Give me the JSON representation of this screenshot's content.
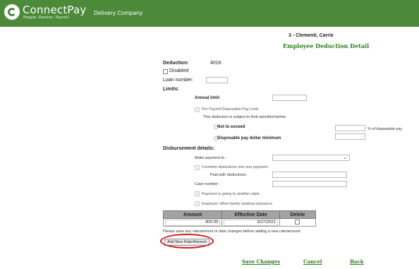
{
  "header": {
    "brand": "ConnectPay",
    "tagline": "People. Passion. Payroll.",
    "company": "Delivery Company",
    "bar_color": "#4c8a3a"
  },
  "employee": {
    "name": "3 - Clementi, Carrie"
  },
  "page": {
    "title": "Employee Deduction Detail"
  },
  "form": {
    "deduction_label": "Deduction:",
    "deduction_value": "401K",
    "disabled_label": "Disabled",
    "disabled_checked": false,
    "loan_number_label": "Loan number:",
    "loan_number_value": "",
    "limits_label": "Limits:",
    "annual_limit_label": "Annual limit:",
    "annual_limit_value": "",
    "per_payroll_label": "Per Payroll Disposable Pay Limit:",
    "subject_note": "This deduction is subject to limit specified below.",
    "not_to_exceed_label": "Not to exceed",
    "not_to_exceed_value": "",
    "pct_disposable_label": "% of disposable pay",
    "disposable_min_label": "Disposable pay dollar minimum",
    "disposable_min_value": "",
    "disbursement_label": "Disbursement details:",
    "make_payment_label": "Make payment to :",
    "make_payment_value": "",
    "combine_label": "Combine deductions into one payment",
    "paid_with_label": "Paid with deductions:",
    "paid_with_value": "",
    "case_number_label": "Case number :",
    "case_number_value": "",
    "another_state_label": "Payment is going to another state",
    "family_medical_label": "Employer offers family medical insurance"
  },
  "rates_table": {
    "headers": [
      "Amount",
      "Effective Date",
      "Delete"
    ],
    "rows": [
      {
        "amount": "300.00",
        "effective_date": "3/27/2021",
        "delete_checked": false
      }
    ]
  },
  "note": "Please save any rate/amount or date changes before adding a new rate/amount.",
  "buttons": {
    "add_new": "Add New Rate/Amount",
    "highlight_color": "#d11919"
  },
  "footer_links": {
    "save": "Save Changes",
    "cancel": "Cancel",
    "back": "Back",
    "link_color": "#2e7d1e"
  }
}
